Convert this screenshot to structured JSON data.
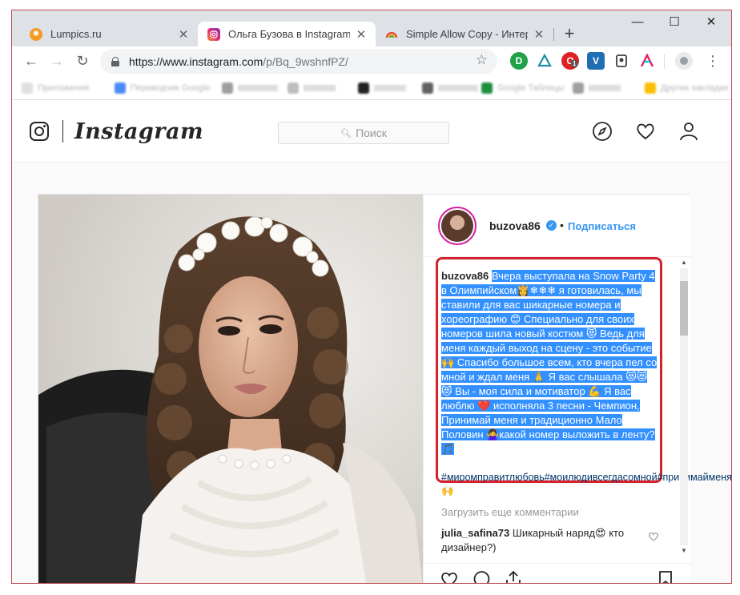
{
  "browser": {
    "tabs": [
      {
        "title": "Lumpics.ru",
        "favicon": "orange-slice-icon",
        "active": false
      },
      {
        "title": "Ольга Бузова в Instagram: «В",
        "favicon": "instagram-icon",
        "active": true
      },
      {
        "title": "Simple Allow Copy - Интернет",
        "favicon": "rainbow-icon",
        "active": false
      }
    ],
    "new_tab": "+",
    "window_controls": {
      "minimize": "—",
      "maximize": "☐",
      "close": "✕"
    },
    "nav": {
      "back": "←",
      "forward": "→",
      "reload": "↻"
    },
    "url": {
      "host": "https://www.instagram.com",
      "path": "/p/Bq_9wshnfPZ/"
    },
    "ext_badge": "1",
    "bookmarks": [
      "Приложения",
      "Переводчик Google",
      "",
      "",
      "",
      "",
      "Google Таблицы",
      "",
      "Другие закладки"
    ]
  },
  "instagram": {
    "wordmark": "Instagram",
    "search_placeholder": "Поиск",
    "post": {
      "username": "buzova86",
      "verified_mark": "✓",
      "dot": "•",
      "follow_label": "Подписаться",
      "caption_user": "buzova86",
      "caption_text": "Вчера выступала на Snow Party 4 в Олимпийском👸❄❄❄ я готовилась, мы ставили для вас шикарные номера и хореографию 😊 Специально для своих номеров шила новый костюм 😻 Ведь для меня каждый выход на сцену - это событие 🙌 Спасибо большое всем, кто вчера пел со мной и ждал меня 🙏 Я вас слышала 😻😻😻 Вы - моя сила и мотиватор 💪 Я вас люблю ❤️ исполняла 3 песни - Чемпион, Принимай меня и традиционно Мало Половин 🙅‍♀️какой номер выложить в ленту? 🎵",
      "hashtags": "#миромправитлюбовь#моилюдивсегдасомной#принимайменя 🙌",
      "load_more": "Загрузить еще комментарии",
      "comment_user": "julia_safina73",
      "comment_text": "Шикарный наряд😍 кто дизайнер?)"
    }
  },
  "colors": {
    "selection": "#3390ff",
    "highlight_border": "#d5212b",
    "link_blue": "#3897f0",
    "hashtag": "#003569"
  }
}
